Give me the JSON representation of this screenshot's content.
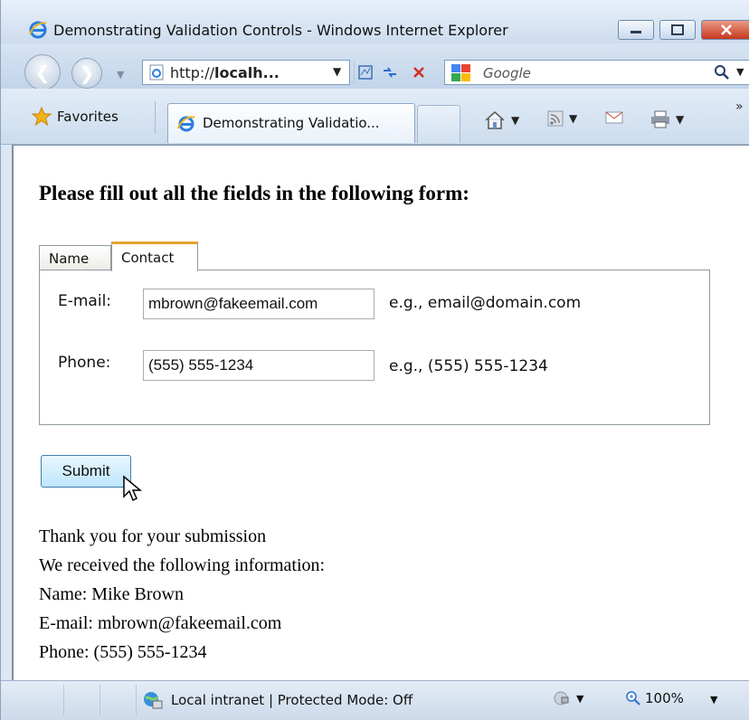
{
  "window": {
    "title": "Demonstrating Validation Controls - Windows Internet Explorer"
  },
  "address_bar": {
    "url_prefix": "http://",
    "url_host": "localh...",
    "search_placeholder": "Google"
  },
  "favorites_bar": {
    "favorites_label": "Favorites",
    "active_tab_label": "Demonstrating Validatio..."
  },
  "page": {
    "heading": "Please fill out all the fields in the following form:",
    "tabs": [
      {
        "label": "Name",
        "selected": false
      },
      {
        "label": "Contact",
        "selected": true
      }
    ],
    "email": {
      "label": "E-mail:",
      "value": "mbrown@fakeemail.com",
      "hint": "e.g., email@domain.com"
    },
    "phone": {
      "label": "Phone:",
      "value": "(555) 555-1234",
      "hint": "e.g., (555) 555-1234"
    },
    "submit_label": "Submit",
    "result_lines": [
      "Thank you for your submission",
      "We received the following information:",
      "Name: Mike Brown",
      "E-mail: mbrown@fakeemail.com",
      "Phone: (555) 555-1234"
    ]
  },
  "status_bar": {
    "zone_text": "Local intranet | Protected Mode: Off",
    "zoom": "100%"
  },
  "colors": {
    "tab_accent": "#e6a32e",
    "submit_border": "#3c7fb1",
    "close_button": "#c8381d"
  }
}
